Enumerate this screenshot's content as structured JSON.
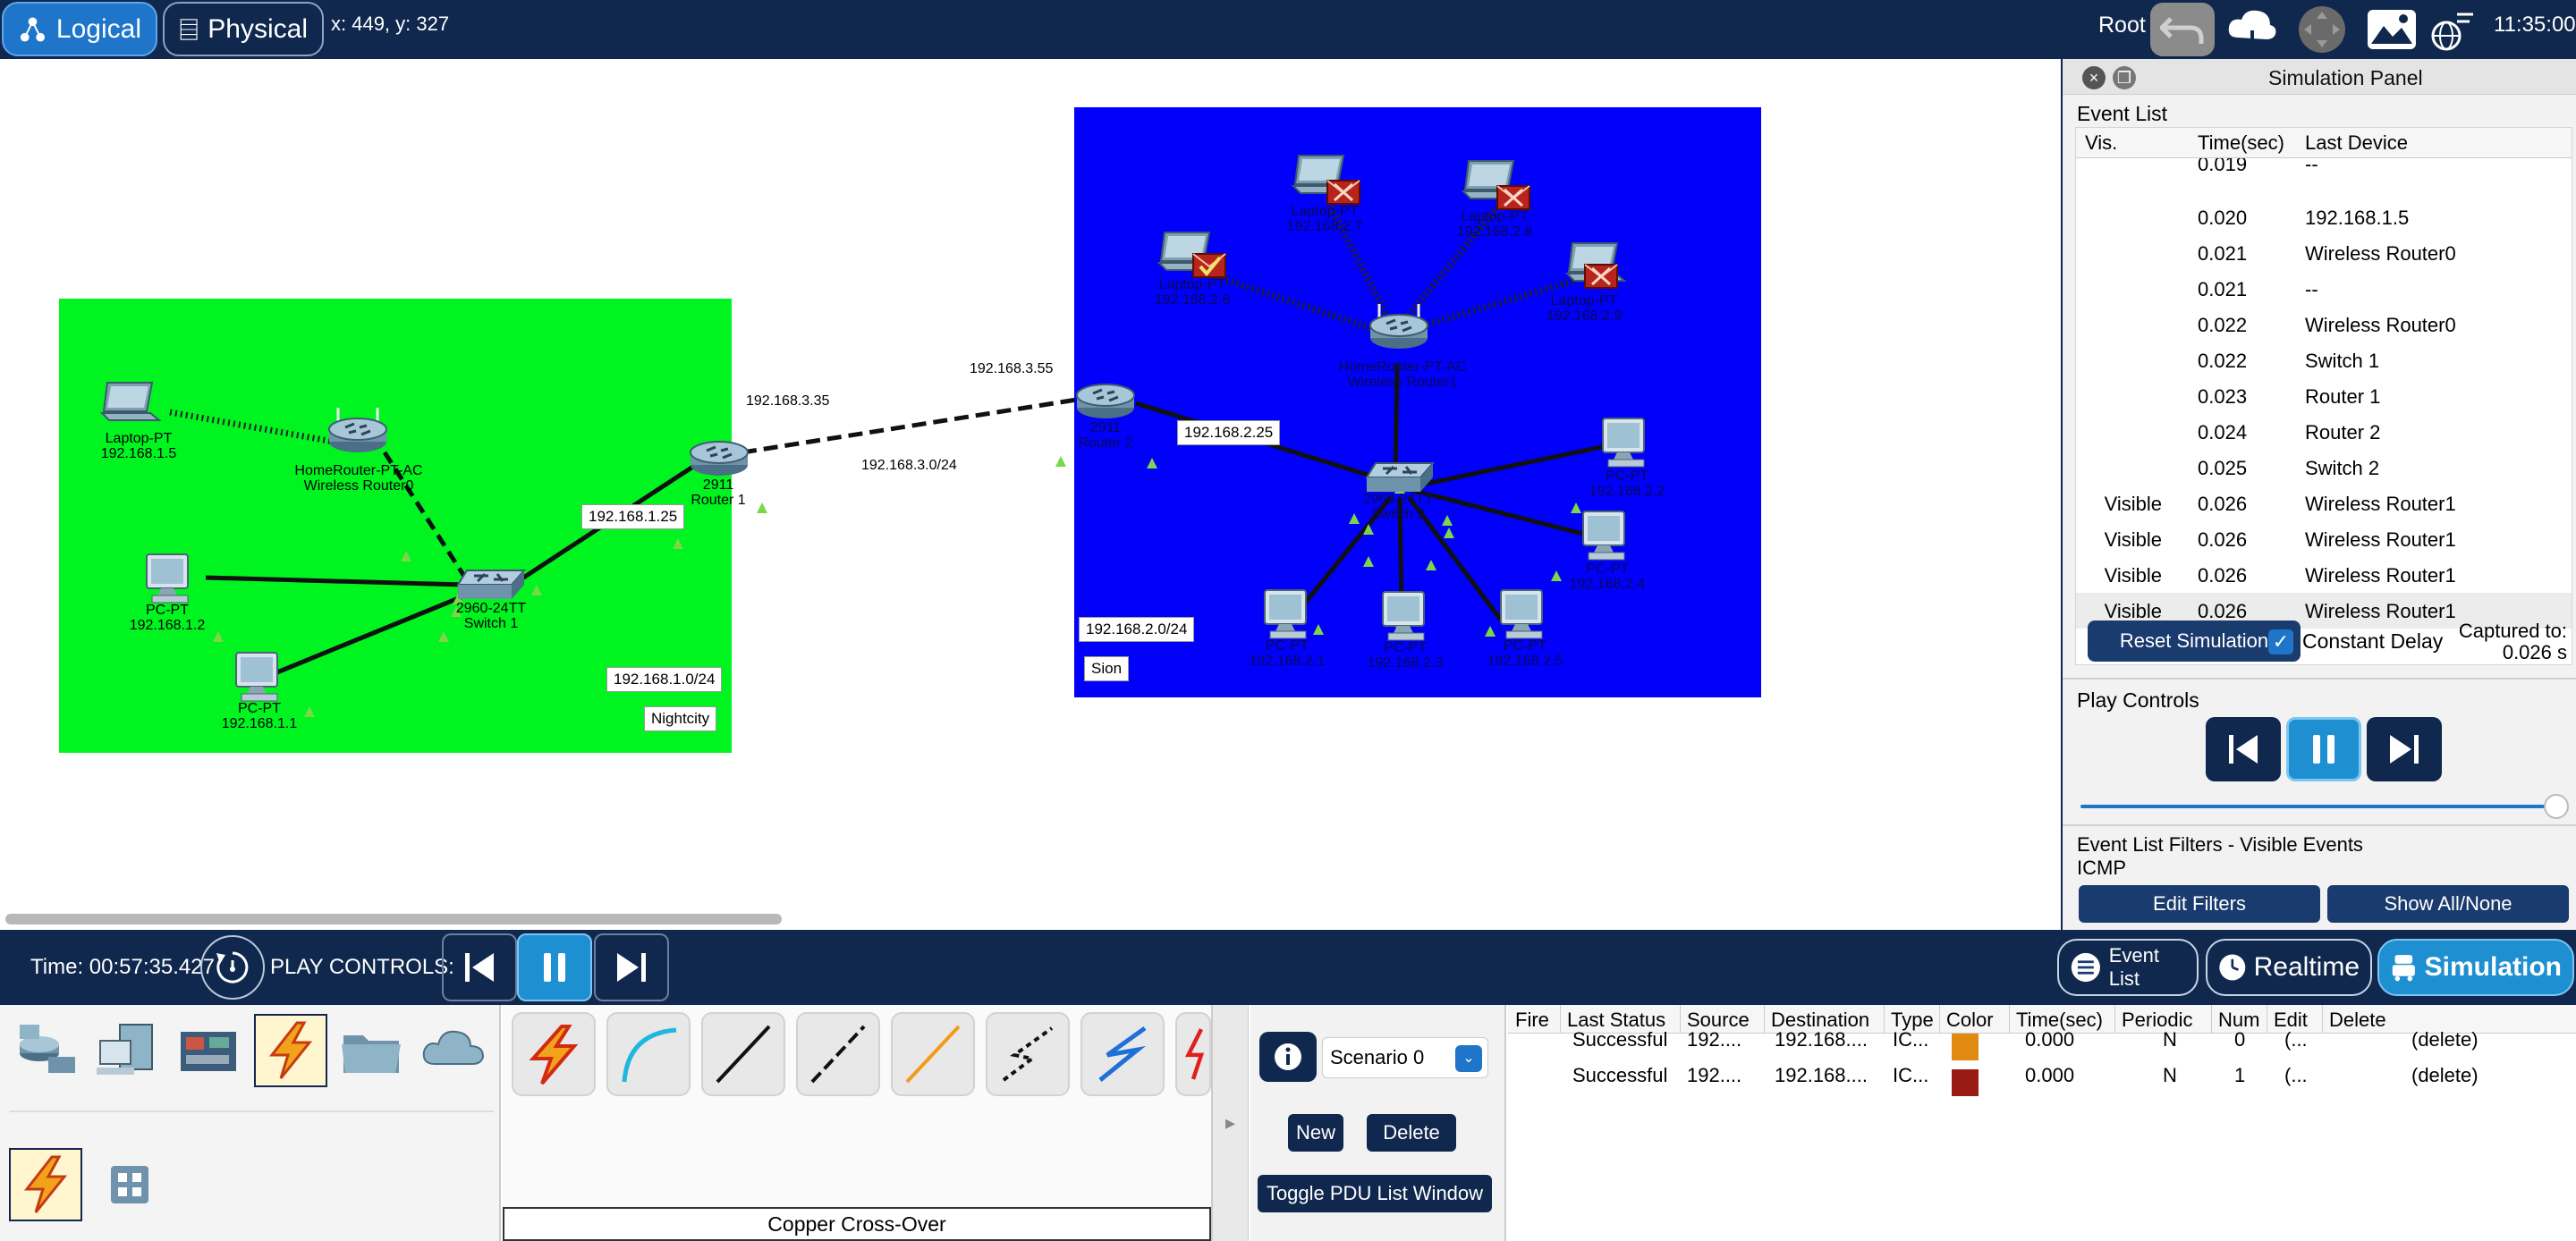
{
  "topbar": {
    "logical_label": "Logical",
    "physical_label": "Physical",
    "coords": "x: 449, y: 327",
    "root_label": "Root",
    "clock": "11:35:00"
  },
  "canvas": {
    "devices": [
      {
        "name": "Laptop-PT",
        "ip": "192.168.1.5"
      },
      {
        "name": "HomeRouter-PT-AC",
        "sub": "Wireless Router0"
      },
      {
        "name": "PC-PT",
        "ip": "192.168.1.2"
      },
      {
        "name": "PC-PT",
        "ip": "192.168.1.1"
      },
      {
        "name": "2960-24TT",
        "sub": "Switch 1"
      },
      {
        "name": "2911",
        "sub": "Router 1"
      },
      {
        "name": "2911",
        "sub": "Router 2"
      },
      {
        "name": "HomeRouter-PT-AC",
        "sub": "Wireless Router1"
      },
      {
        "name": "Laptop-PT",
        "ip": "192.168.2.6"
      },
      {
        "name": "Laptop-PT",
        "ip": "192.168.2.7"
      },
      {
        "name": "Laptop-PT",
        "ip": "192.168.2.8"
      },
      {
        "name": "Laptop-PT",
        "ip": "192.168.2.9"
      },
      {
        "name": "2960-24TT",
        "sub": "Switch 2"
      },
      {
        "name": "PC-PT",
        "ip": "192.168.2.2"
      },
      {
        "name": "PC-PT",
        "ip": "192.168.2.4"
      },
      {
        "name": "PC-PT",
        "ip": "192.168.2.1"
      },
      {
        "name": "PC-PT",
        "ip": "192.168.2.3"
      },
      {
        "name": "PC-PT",
        "ip": "192.168.2.5"
      }
    ],
    "link_labels": {
      "r1_wan": "192.168.3.35",
      "r2_wan": "192.168.3.55",
      "wan_net": "192.168.3.0/24",
      "r1_lan": "192.168.1.25",
      "r2_lan": "192.168.2.25"
    },
    "notes": {
      "green_net": "192.168.1.0/24",
      "green_name": "Nightcity",
      "blue_net": "192.168.2.0/24",
      "blue_name": "Sion"
    }
  },
  "simulation_panel": {
    "title": "Simulation Panel",
    "event_list_label": "Event List",
    "columns": [
      "Vis.",
      "Time(sec)",
      "Last Device"
    ],
    "events": [
      {
        "vis": "",
        "time": "0.019",
        "device": "--"
      },
      {
        "vis": "",
        "time": "0.020",
        "device": "192.168.1.5"
      },
      {
        "vis": "",
        "time": "0.021",
        "device": "Wireless Router0"
      },
      {
        "vis": "",
        "time": "0.021",
        "device": "--"
      },
      {
        "vis": "",
        "time": "0.022",
        "device": "Wireless Router0"
      },
      {
        "vis": "",
        "time": "0.022",
        "device": "Switch 1"
      },
      {
        "vis": "",
        "time": "0.023",
        "device": "Router 1"
      },
      {
        "vis": "",
        "time": "0.024",
        "device": "Router 2"
      },
      {
        "vis": "",
        "time": "0.025",
        "device": "Switch 2"
      },
      {
        "vis": "Visible",
        "time": "0.026",
        "device": "Wireless Router1"
      },
      {
        "vis": "Visible",
        "time": "0.026",
        "device": "Wireless Router1"
      },
      {
        "vis": "Visible",
        "time": "0.026",
        "device": "Wireless Router1"
      },
      {
        "vis": "Visible",
        "time": "0.026",
        "device": "Wireless Router1"
      }
    ],
    "reset_label": "Reset Simulation",
    "constant_delay_label": "Constant Delay",
    "constant_delay_checked": true,
    "captured_label": "Captured to:",
    "captured_value": "0.026 s",
    "play_controls_label": "Play Controls",
    "filters_label": "Event List Filters - Visible Events",
    "filters_value": "ICMP",
    "edit_filters_label": "Edit Filters",
    "show_all_label": "Show All/None"
  },
  "timebar": {
    "time": "Time: 00:57:35.427",
    "play_controls_label": "PLAY CONTROLS:",
    "event_list_label": "Event List",
    "realtime_label": "Realtime",
    "simulation_label": "Simulation"
  },
  "bottom": {
    "connection_name": "Copper Cross-Over",
    "scenario": "Scenario 0",
    "new_label": "New",
    "delete_label": "Delete",
    "toggle_label": "Toggle PDU List Window",
    "pdu_columns": [
      "Fire",
      "Last Status",
      "Source",
      "Destination",
      "Type",
      "Color",
      "Time(sec)",
      "Periodic",
      "Num",
      "Edit",
      "Delete"
    ],
    "pdus": [
      {
        "status": "Successful",
        "source": "192....",
        "destination": "192.168....",
        "type": "IC...",
        "color": "#e08a12",
        "time": "0.000",
        "periodic": "N",
        "num": "0",
        "edit": "(...",
        "delete": "(delete)"
      },
      {
        "status": "Successful",
        "source": "192....",
        "destination": "192.168....",
        "type": "IC...",
        "color": "#9a1a14",
        "time": "0.000",
        "periodic": "N",
        "num": "1",
        "edit": "(...",
        "delete": "(delete)"
      }
    ]
  },
  "colors": {
    "topbar": "#10284d",
    "accent": "#1e75c9",
    "green_cluster": "#00f520",
    "blue_cluster": "#0000fb"
  },
  "icons": [
    "logical-icon",
    "physical-icon",
    "undo-icon",
    "cloud-icon",
    "move-icon",
    "background-icon",
    "network-time-icon",
    "close-icon",
    "restore-icon",
    "step-back-icon",
    "pause-icon",
    "step-forward-icon",
    "reset-time-icon",
    "event-list-icon",
    "realtime-clock-icon",
    "simulation-icon",
    "info-icon"
  ]
}
